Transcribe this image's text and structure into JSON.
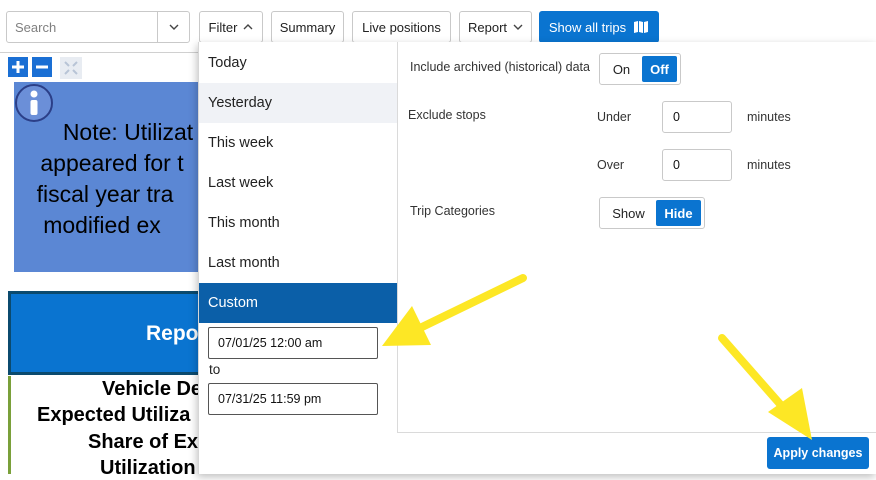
{
  "toolbar": {
    "search_placeholder": "Search",
    "filter_label": "Filter",
    "summary_label": "Summary",
    "live_positions_label": "Live positions",
    "report_label": "Report",
    "show_all_trips_label": "Show all trips"
  },
  "background": {
    "note_lines": [
      "Note: Utilizat",
      "appeared for t",
      "fiscal year tra",
      "modified ex"
    ],
    "report_header": "Repo",
    "bold_lines": [
      "Vehicle De",
      "Expected Utiliza",
      "Share of Ex",
      "Utilization"
    ]
  },
  "filter_menu": {
    "items": [
      "Today",
      "Yesterday",
      "This week",
      "Last week",
      "This month",
      "Last month",
      "Custom"
    ],
    "hovered": "Yesterday",
    "selected": "Custom",
    "from_value": "07/01/25 12:00 am",
    "to_label": "to",
    "to_value": "07/31/25 11:59 pm"
  },
  "options": {
    "archived_label": "Include archived (historical) data",
    "archived_on": "On",
    "archived_off": "Off",
    "archived_selected": "Off",
    "exclude_stops_label": "Exclude stops",
    "under_label": "Under",
    "under_value": "0",
    "over_label": "Over",
    "over_value": "0",
    "minutes_label": "minutes",
    "trip_categories_label": "Trip Categories",
    "show_label": "Show",
    "hide_label": "Hide",
    "trip_categories_selected": "Hide"
  },
  "apply_label": "Apply changes",
  "colors": {
    "primary": "#0a74d0",
    "menu_selected": "#0b5fa8",
    "menu_hover": "#f0f2f6",
    "annotation_arrow": "#fde725"
  }
}
